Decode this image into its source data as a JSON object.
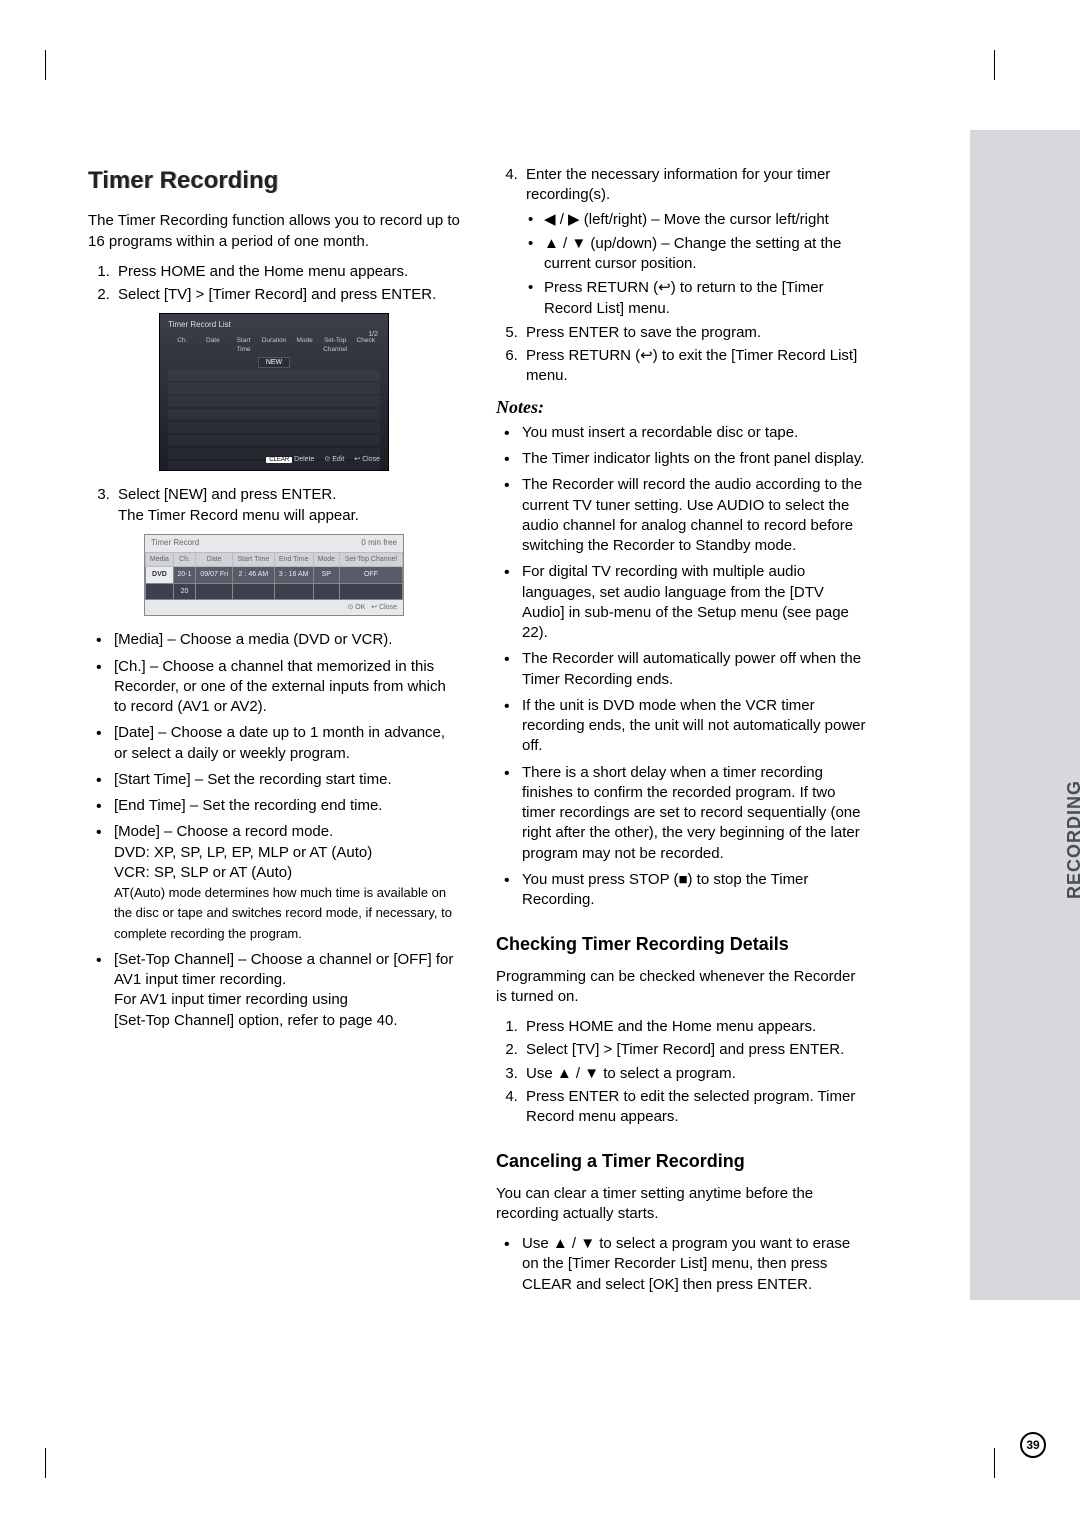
{
  "sidebar": {
    "label": "RECORDING"
  },
  "pageNumber": "39",
  "left": {
    "title": "Timer Recording",
    "intro": "The Timer Recording function allows you to record up to 16 programs within a period of one month.",
    "steps_a": [
      "Press HOME and the Home menu appears.",
      "Select [TV] > [Timer Record] and press ENTER."
    ],
    "shot1": {
      "title": "Timer Record List",
      "page": "1/2",
      "cols": [
        "Ch.",
        "Date",
        "Start Time",
        "Duration",
        "Mode",
        "Set-Top Channel",
        "Check"
      ],
      "newLabel": "NEW",
      "footer": {
        "clear": "CLEAR",
        "delete": "Delete",
        "edit": "⊙ Edit",
        "close": "↩ Close"
      }
    },
    "step3a": "Select [NEW] and press ENTER.",
    "step3b": "The Timer Record menu will appear.",
    "shot2": {
      "title": "Timer Record",
      "free": "0   min free",
      "head": [
        "Media",
        "Ch.",
        "Date",
        "Start Time",
        "End Time",
        "Mode",
        "Set-Top Channel"
      ],
      "row": [
        "DVD",
        "20-1",
        "09/07 Fri",
        "2 : 46 AM",
        "3 : 16 AM",
        "SP",
        "OFF"
      ],
      "sub": "20",
      "foot": {
        "ok": "⊙ OK",
        "close": "↩ Close"
      }
    },
    "fields": [
      "[Media] – Choose a media (DVD or VCR).",
      "[Ch.] – Choose a channel that memorized in this Recorder, or one of the external inputs from which to record (AV1 or AV2).",
      "[Date] – Choose a date up to 1 month in advance, or select a daily or weekly program.",
      "[Start Time] – Set the recording start time.",
      "[End Time] – Set the recording end time."
    ],
    "modeField": {
      "l1": "[Mode] – Choose a record mode.",
      "l2": "DVD: XP, SP, LP, EP, MLP or AT (Auto)",
      "l3": "VCR: SP, SLP or AT (Auto)",
      "note": "AT(Auto) mode determines how much time is available on the disc or tape and switches record mode, if necessary, to complete recording the program."
    },
    "settop": {
      "l1": "[Set-Top Channel] – Choose a channel or [OFF] for AV1 input timer recording.",
      "l2": "For AV1 input timer recording using",
      "l3": "[Set-Top Channel] option, refer to page 40."
    }
  },
  "right": {
    "step4": {
      "lead": "Enter the necessary information for your timer recording(s).",
      "sub": [
        "◀ / ▶ (left/right) – Move the cursor left/right",
        "▲ / ▼ (up/down) – Change the setting at the current cursor position.",
        "Press RETURN (↩) to return to the [Timer Record List] menu."
      ]
    },
    "step5": "Press ENTER to save the program.",
    "step6": "Press RETURN (↩) to exit the [Timer Record List] menu.",
    "notesHeader": "Notes:",
    "notes": [
      "You must insert a recordable disc or tape.",
      "The Timer indicator lights on the front panel display.",
      "The Recorder will record the audio according to the current TV tuner setting. Use AUDIO to select the audio channel for analog channel to record before switching the Recorder to Standby mode.",
      "For digital TV recording with multiple audio languages, set audio language from the [DTV Audio] in sub-menu of the Setup menu (see page 22).",
      "The Recorder will automatically power off when the Timer Recording ends.",
      "If the unit is DVD mode when the VCR timer recording ends, the unit will not automatically power off.",
      "There is a short delay when a timer recording finishes to confirm the recorded program. If two timer recordings are set to record sequentially (one right after the other), the very beginning of the later program may not be recorded.",
      "You must press STOP (■) to stop the Timer Recording."
    ],
    "check": {
      "title": "Checking Timer Recording Details",
      "intro": "Programming can be checked whenever the Recorder is turned on.",
      "steps": [
        "Press HOME and the Home menu appears.",
        "Select [TV] > [Timer Record] and press ENTER.",
        "Use ▲ / ▼ to select a program.",
        "Press ENTER to edit the selected program. Timer Record menu appears."
      ]
    },
    "cancel": {
      "title": "Canceling a Timer Recording",
      "intro": "You can clear a timer setting anytime before the recording actually starts.",
      "bullet": "Use ▲ / ▼ to select a program you want to erase on the [Timer Recorder List] menu, then press CLEAR and select [OK] then press ENTER."
    }
  }
}
